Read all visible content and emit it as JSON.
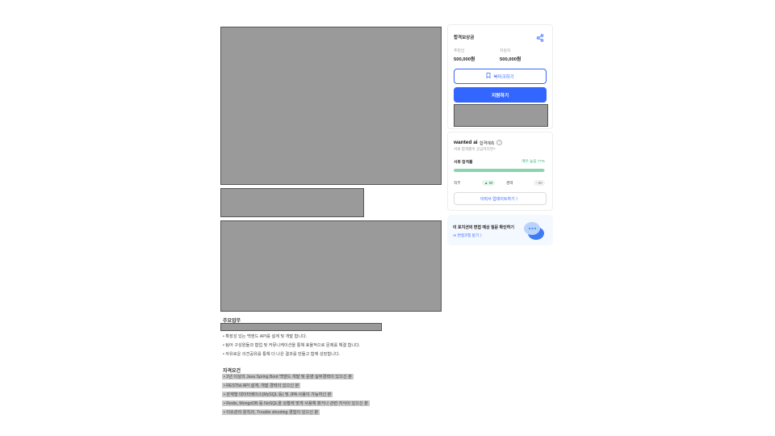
{
  "reward": {
    "title": "합격보상금",
    "referrer_label": "추천인",
    "referrer_value": "500,000원",
    "applicant_label": "지원자",
    "applicant_value": "500,000원",
    "bookmark_label": "북마크하기",
    "apply_label": "지원하기"
  },
  "ai": {
    "logo": "wanted ai",
    "name": "합격예측",
    "subtitle": "서류 합격률이 궁금하다면?",
    "rate_label": "서류 합격률",
    "rate_value": "매우 높음 77%",
    "rate_fraction": 0.99,
    "job_label": "직무",
    "job_chip": "▲ 99",
    "exp_label": "경력",
    "exp_chip": "- 99",
    "upgrade_label": "이력서 업데이트하기 〉"
  },
  "interview": {
    "title": "이 포지션의 면접 예상 질문 확인하기",
    "link": "AI 면접코칭 받기 〉"
  },
  "content": {
    "duties_title": "주요업무",
    "duties": [
      "• 확장성 있는 백엔드 API를 설계 및 개발 합니다.",
      "• 팀어 구성원들과 협업 및 커뮤니케이션을 통해 효율적으로 문제를 해결 합니다.",
      "• 자유로운 의견공유를 통해 더 나은 결과를 만들고 함께 성장합니다."
    ],
    "requirements_title": "자격요건",
    "requirements": [
      "• 2년 이상의 Java Spring Boot 백엔드 개발 및 운영 실무경력이 있으신 분",
      "• RESTful API 설계, 개발 경력이 있으신 분",
      "• 관계형 데이터베이스(MySQL 등) 및 JPA 사용이 가능하신 분",
      "• Redis, MongoDB 등 NoSQL을 상황에 맞게 사용해 봤거나 관련 지식이 있으신 분",
      "• 이슈관리 원칙과, Trouble shooting 경험이 있으신 분"
    ]
  },
  "colors": {
    "accent": "#3366ff",
    "success": "#36b37e",
    "placeholder": "#9a9a9a"
  }
}
